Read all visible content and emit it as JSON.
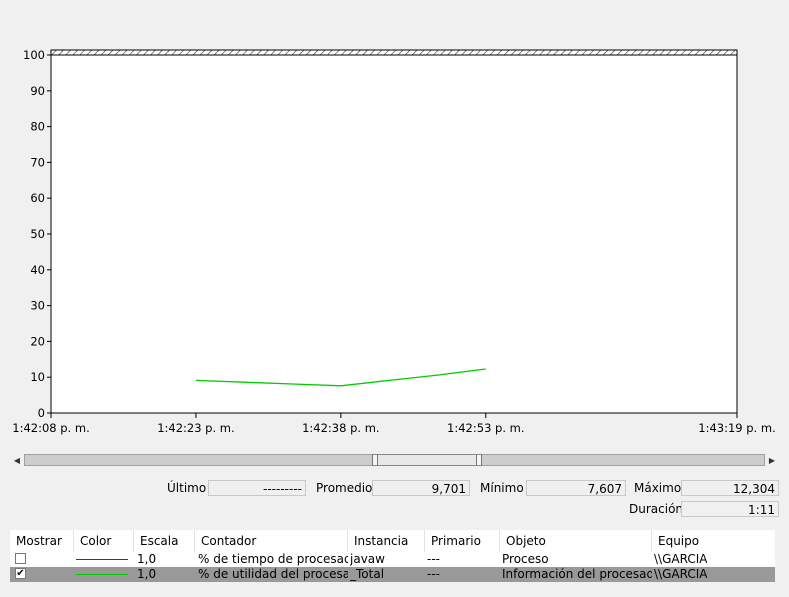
{
  "chart_data": {
    "type": "line",
    "ylim": [
      0,
      100
    ],
    "y_ticks": [
      "0",
      "10",
      "20",
      "30",
      "40",
      "50",
      "60",
      "70",
      "80",
      "90",
      "100"
    ],
    "x_tick_labels": [
      "1:42:08 p. m.",
      "1:42:23 p. m.",
      "1:42:38 p. m.",
      "1:42:53 p. m.",
      "1:43:19 p. m."
    ],
    "x_tick_seconds": [
      0,
      15,
      30,
      45,
      71
    ],
    "grid": false,
    "series": [
      {
        "name": "% de utilidad del procesador",
        "color": "#00cc00",
        "x_seconds": [
          15,
          20,
          25,
          30,
          35,
          40,
          45
        ],
        "values": [
          9.1,
          8.6,
          8.1,
          7.6,
          9.1,
          10.6,
          12.3
        ]
      }
    ]
  },
  "stats": {
    "ultimo_label": "Último",
    "ultimo_value": "---------",
    "promedio_label": "Promedio",
    "promedio_value": "9,701",
    "minimo_label": "Mínimo",
    "minimo_value": "7,607",
    "maximo_label": "Máximo",
    "maximo_value": "12,304",
    "duracion_label": "Duración",
    "duracion_value": "1:11"
  },
  "table": {
    "headers": {
      "mostrar": "Mostrar",
      "color": "Color",
      "escala": "Escala",
      "contador": "Contador",
      "instancia": "Instancia",
      "primario": "Primario",
      "objeto": "Objeto",
      "equipo": "Equipo"
    },
    "rows": [
      {
        "checked": false,
        "check_mark": "",
        "color": "#cc0000",
        "escala": "1,0",
        "contador": "% de tiempo de procesador",
        "instancia": "javaw",
        "primario": "---",
        "objeto": "Proceso",
        "equipo": "\\\\GARCIA"
      },
      {
        "checked": true,
        "check_mark": "✔",
        "color": "#00cc00",
        "escala": "1,0",
        "contador": "% de utilidad del procesa...",
        "instancia": "_Total",
        "primario": "---",
        "objeto": "Información del procesad...",
        "equipo": "\\\\GARCIA"
      }
    ]
  },
  "icons": {
    "scroll_left": "◀",
    "scroll_right": "▶"
  }
}
